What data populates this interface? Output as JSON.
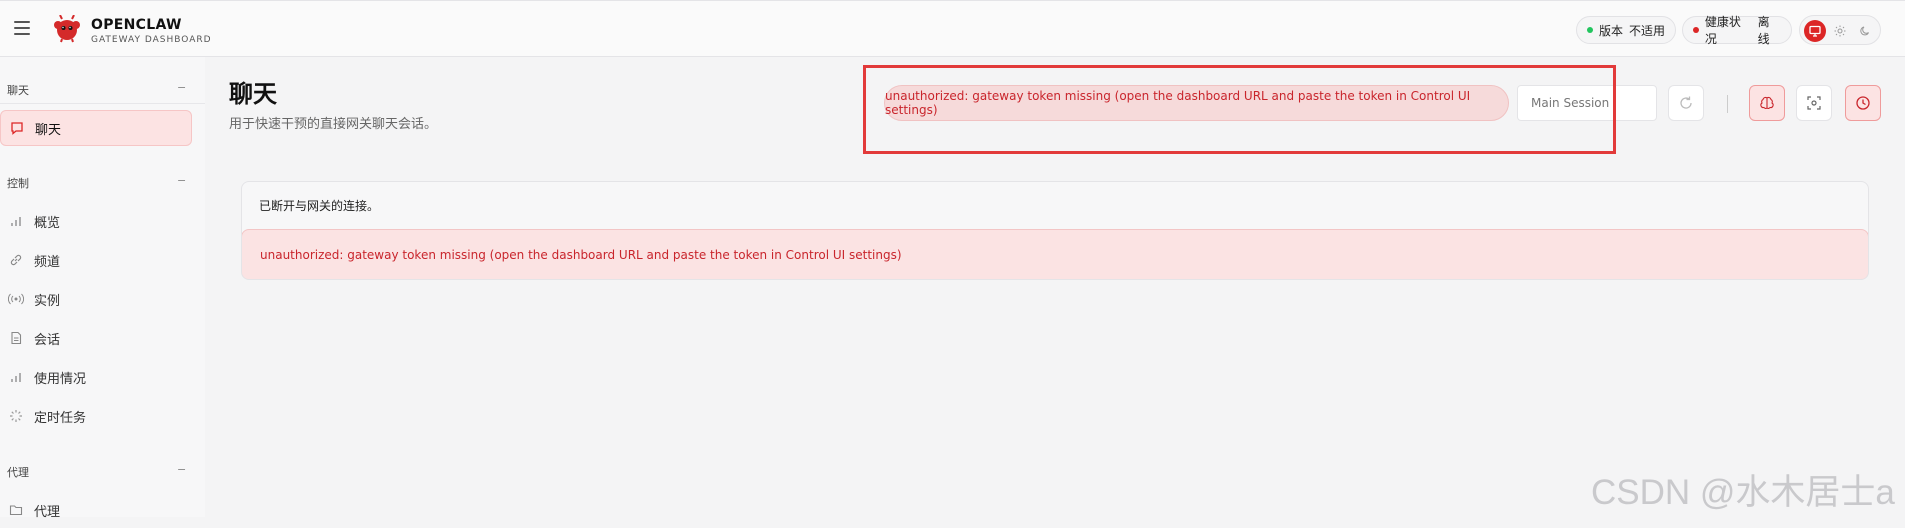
{
  "brand": {
    "title": "OPENCLAW",
    "subtitle": "GATEWAY DASHBOARD"
  },
  "header": {
    "version": {
      "label": "版本",
      "value": "不适用",
      "dot_color": "#22c55e"
    },
    "health": {
      "label": "健康状况",
      "value": "离线",
      "dot_color": "#dc2626"
    },
    "theme_options": [
      "monitor-icon",
      "sun-icon",
      "moon-icon"
    ],
    "theme_active": "monitor-icon"
  },
  "sidebar": {
    "sections": [
      {
        "title": "聊天",
        "items": [
          {
            "label": "聊天",
            "icon": "chat-bubble-icon",
            "active": true
          }
        ]
      },
      {
        "title": "控制",
        "items": [
          {
            "label": "概览",
            "icon": "bar-chart-icon"
          },
          {
            "label": "频道",
            "icon": "link-icon"
          },
          {
            "label": "实例",
            "icon": "radio-waves-icon"
          },
          {
            "label": "会话",
            "icon": "document-icon"
          },
          {
            "label": "使用情况",
            "icon": "bar-chart-icon"
          },
          {
            "label": "定时任务",
            "icon": "spinner-icon"
          }
        ]
      },
      {
        "title": "代理",
        "items": [
          {
            "label": "代理",
            "icon": "folder-icon"
          }
        ]
      }
    ],
    "collapse_glyph": "−"
  },
  "main": {
    "title": "聊天",
    "subtitle": "用于快速干预的直接网关聊天会话。",
    "error_banner": "unauthorized: gateway token missing (open the dashboard URL and paste the token in Control UI settings)",
    "session_placeholder": "Main Session",
    "toolbar_icons": [
      "refresh-icon",
      "brain-icon",
      "focus-icon",
      "clock-icon"
    ],
    "status_text": "已断开与网关的连接。",
    "error_text": "unauthorized: gateway token missing (open the dashboard URL and paste the token in Control UI settings)"
  },
  "watermark": "CSDN @水木居士a",
  "colors": {
    "accent": "#dc2626",
    "error_text": "#c9252c",
    "error_bg": "#fbe3e3"
  }
}
